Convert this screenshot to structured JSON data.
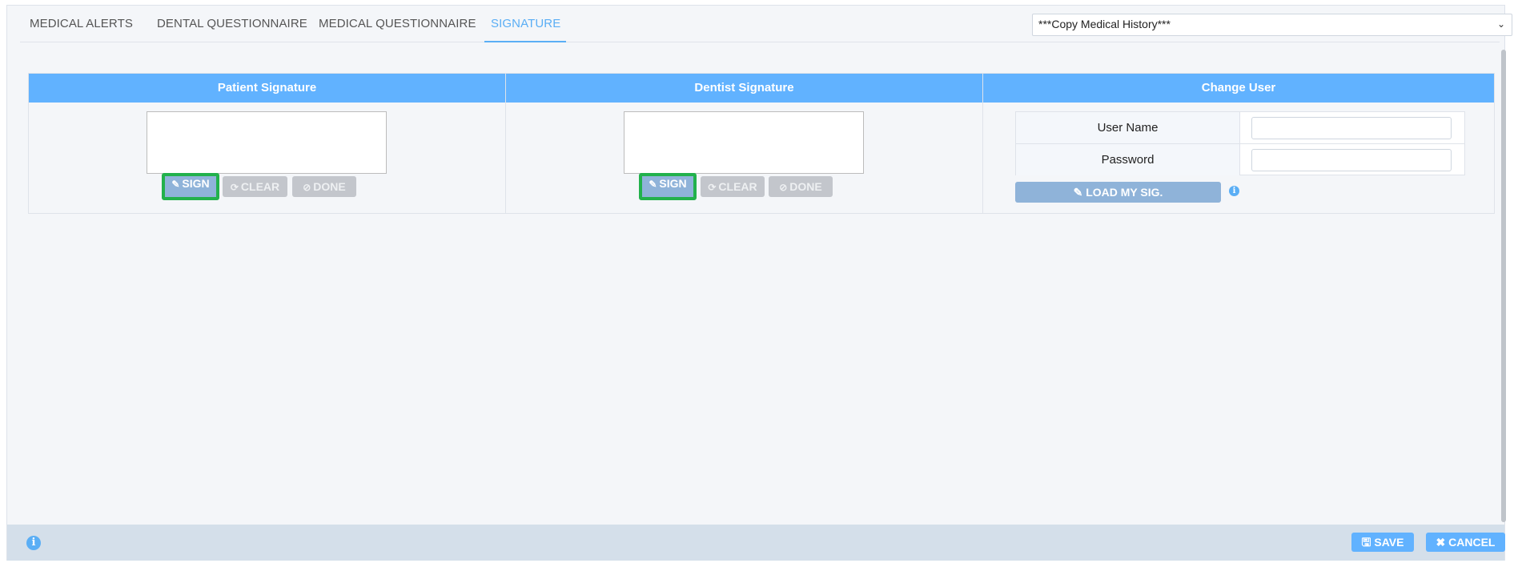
{
  "tabs": [
    {
      "label": "MEDICAL ALERTS"
    },
    {
      "label": "DENTAL QUESTIONNAIRE"
    },
    {
      "label": "MEDICAL QUESTIONNAIRE"
    },
    {
      "label": "SIGNATURE",
      "active": true
    }
  ],
  "copy_select": {
    "value": "***Copy Medical History***"
  },
  "columns": {
    "patient": {
      "title": "Patient Signature",
      "sign": "SIGN",
      "clear": "CLEAR",
      "done": "DONE"
    },
    "dentist": {
      "title": "Dentist Signature",
      "sign": "SIGN",
      "clear": "CLEAR",
      "done": "DONE"
    },
    "change_user": {
      "title": "Change User",
      "username_label": "User Name",
      "password_label": "Password",
      "load_button": "LOAD MY SIG."
    }
  },
  "footer": {
    "save_label": "SAVE",
    "cancel_label": "CANCEL"
  },
  "icons": {
    "info": "info-icon",
    "pencil": "pencil-icon",
    "refresh": "refresh-icon",
    "check": "check-circle-icon",
    "save": "save-icon",
    "close": "close-icon"
  },
  "colors": {
    "accent": "#61b2ff",
    "highlight": "#22b14c",
    "disabled": "#c3c6cc"
  }
}
